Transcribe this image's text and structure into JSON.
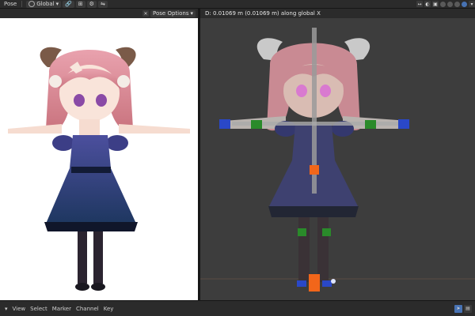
{
  "topbar": {
    "mode": "Pose",
    "orientation": "Global",
    "orientation_caret": "▾"
  },
  "left_header": {
    "pose_options": "Pose Options",
    "caret": "▾"
  },
  "right_header": {
    "status": "D: 0.01069 m (0.01069 m) along global X"
  },
  "timeline": {
    "menu": [
      "View",
      "Select",
      "Marker",
      "Channel",
      "Key"
    ]
  },
  "colors": {
    "bone_x": "#2a48c8",
    "bone_y": "#2a8a2a",
    "bone_active": "#f2661a",
    "accent": "#4772b3"
  }
}
